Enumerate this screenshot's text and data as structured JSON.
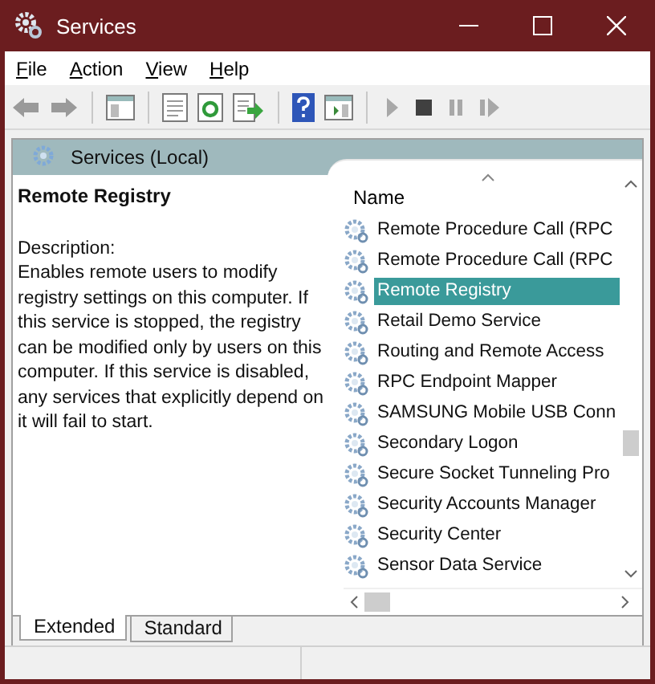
{
  "window": {
    "title": "Services"
  },
  "menu": [
    {
      "label": "File"
    },
    {
      "label": "Action"
    },
    {
      "label": "View"
    },
    {
      "label": "Help"
    }
  ],
  "toolbar": [
    {
      "kind": "back",
      "disabled": true
    },
    {
      "kind": "forward",
      "disabled": true
    },
    {
      "kind": "sep"
    },
    {
      "kind": "tree"
    },
    {
      "kind": "sep"
    },
    {
      "kind": "properties"
    },
    {
      "kind": "refresh"
    },
    {
      "kind": "export"
    },
    {
      "kind": "sep"
    },
    {
      "kind": "help"
    },
    {
      "kind": "pane"
    },
    {
      "kind": "sep"
    },
    {
      "kind": "start",
      "disabled": true
    },
    {
      "kind": "stop",
      "disabled": false
    },
    {
      "kind": "pause",
      "disabled": true
    },
    {
      "kind": "resume",
      "disabled": true
    }
  ],
  "header": {
    "title": "Services (Local)"
  },
  "details": {
    "name": "Remote Registry",
    "description_label": "Description:",
    "description": "Enables remote users to modify registry settings on this computer. If this service is stopped, the registry can be modified only by users on this computer. If this service is disabled, any services that explicitly depend on it will fail to start."
  },
  "list": {
    "column": "Name",
    "rows": [
      {
        "name": "Remote Procedure Call (RPC",
        "selected": false
      },
      {
        "name": "Remote Procedure Call (RPC",
        "selected": false
      },
      {
        "name": "Remote Registry",
        "selected": true
      },
      {
        "name": "Retail Demo Service",
        "selected": false
      },
      {
        "name": "Routing and Remote Access",
        "selected": false
      },
      {
        "name": "RPC Endpoint Mapper",
        "selected": false
      },
      {
        "name": "SAMSUNG Mobile USB Conn",
        "selected": false
      },
      {
        "name": "Secondary Logon",
        "selected": false
      },
      {
        "name": "Secure Socket Tunneling Pro",
        "selected": false
      },
      {
        "name": "Security Accounts Manager",
        "selected": false
      },
      {
        "name": "Security Center",
        "selected": false
      },
      {
        "name": "Sensor Data Service",
        "selected": false
      }
    ]
  },
  "tabs": [
    {
      "label": "Extended",
      "selected": true
    },
    {
      "label": "Standard",
      "selected": false
    }
  ]
}
